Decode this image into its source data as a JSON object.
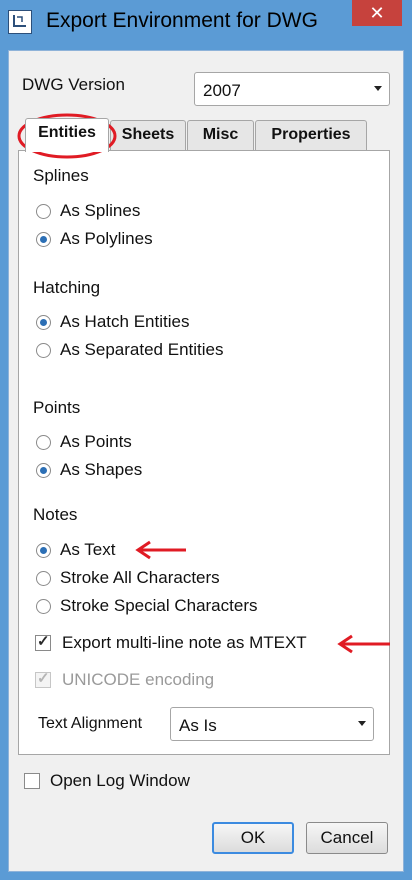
{
  "window": {
    "title": "Export Environment for DWG",
    "close_glyph": "✕"
  },
  "dwg_version": {
    "label": "DWG Version",
    "value": "2007"
  },
  "tabs": [
    {
      "label": "Entities",
      "active": true
    },
    {
      "label": "Sheets",
      "active": false
    },
    {
      "label": "Misc",
      "active": false
    },
    {
      "label": "Properties",
      "active": false
    }
  ],
  "splines": {
    "heading": "Splines",
    "options": [
      "As Splines",
      "As Polylines"
    ],
    "selected": "As Polylines"
  },
  "hatching": {
    "heading": "Hatching",
    "options": [
      "As Hatch Entities",
      "As Separated Entities"
    ],
    "selected": "As Hatch Entities"
  },
  "points": {
    "heading": "Points",
    "options": [
      "As Points",
      "As Shapes"
    ],
    "selected": "As Shapes"
  },
  "notes": {
    "heading": "Notes",
    "options": [
      "As Text",
      "Stroke All Characters",
      "Stroke Special Characters"
    ],
    "selected": "As Text",
    "mtext": {
      "label": "Export multi-line note as MTEXT",
      "checked": true
    },
    "unicode": {
      "label": "UNICODE encoding",
      "checked": true,
      "enabled": false
    },
    "text_alignment": {
      "label": "Text Alignment",
      "value": "As Is"
    }
  },
  "log_window": {
    "label": "Open Log Window",
    "checked": false
  },
  "buttons": {
    "ok": "OK",
    "cancel": "Cancel"
  },
  "annotation_color": "#e01b24"
}
